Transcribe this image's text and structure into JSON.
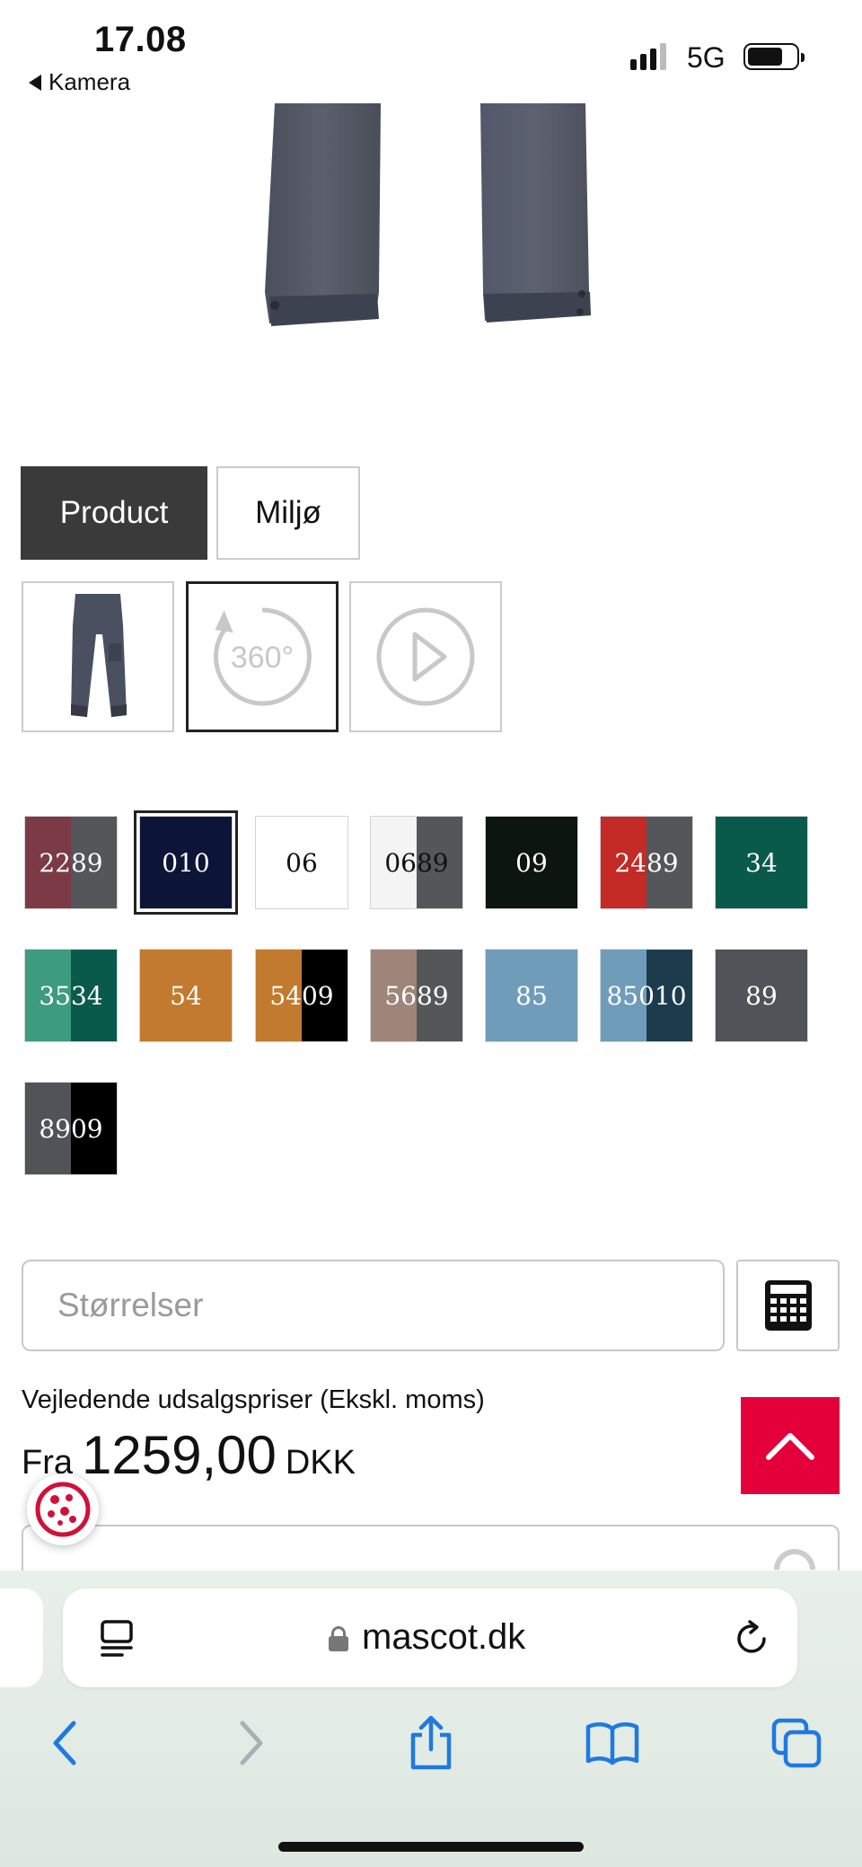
{
  "status_bar": {
    "time": "17.08",
    "back_app": "Kamera",
    "network": "5G"
  },
  "tabs": [
    {
      "label": "Product",
      "active": true
    },
    {
      "label": "Miljø",
      "active": false
    }
  ],
  "media": [
    {
      "type": "image",
      "icon": "trousers-thumbnail"
    },
    {
      "type": "360",
      "label": "360°",
      "icon": "rotate-360-icon",
      "selected": true
    },
    {
      "type": "video",
      "icon": "play-icon"
    }
  ],
  "colors": [
    {
      "code": "2289",
      "fill": [
        "#7c3a47",
        "#555659"
      ],
      "text": "#ffffff",
      "selected": false
    },
    {
      "code": "010",
      "fill": [
        "#0c1438"
      ],
      "text": "#ffffff",
      "selected": true
    },
    {
      "code": "06",
      "fill": [
        "#ffffff"
      ],
      "text": "#111111",
      "selected": false
    },
    {
      "code": "0689",
      "fill": [
        "#f4f4f4",
        "#555659"
      ],
      "text": "#111111",
      "selected": false
    },
    {
      "code": "09",
      "fill": [
        "#0d1510"
      ],
      "text": "#ffffff",
      "selected": false
    },
    {
      "code": "2489",
      "fill": [
        "#c42a26",
        "#555659"
      ],
      "text": "#ffffff",
      "selected": false
    },
    {
      "code": "34",
      "fill": [
        "#0a5a4c"
      ],
      "text": "#ffffff",
      "selected": false
    },
    {
      "code": "3534",
      "fill": [
        "#3d9b80",
        "#0a5a4c"
      ],
      "text": "#ffffff",
      "selected": false
    },
    {
      "code": "54",
      "fill": [
        "#c27a2f"
      ],
      "text": "#ffffff",
      "selected": false
    },
    {
      "code": "5409",
      "fill": [
        "#c27a2f",
        "#000000"
      ],
      "text": "#ffffff",
      "selected": false
    },
    {
      "code": "5689",
      "fill": [
        "#9e8479",
        "#555659"
      ],
      "text": "#ffffff",
      "selected": false
    },
    {
      "code": "85",
      "fill": [
        "#6f9db9"
      ],
      "text": "#ffffff",
      "selected": false
    },
    {
      "code": "85010",
      "fill": [
        "#6f9db9",
        "#1c3c4e"
      ],
      "text": "#ffffff",
      "selected": false
    },
    {
      "code": "89",
      "fill": [
        "#505357"
      ],
      "text": "#ffffff",
      "selected": false
    },
    {
      "code": "8909",
      "fill": [
        "#505357",
        "#000000"
      ],
      "text": "#ffffff",
      "selected": false
    }
  ],
  "size_selector": {
    "placeholder": "Størrelser",
    "calculator_icon": "calculator-icon"
  },
  "price": {
    "note": "Vejledende udsalgspriser (Ekskl. moms)",
    "prefix": "Fra",
    "value": "1259,00",
    "currency": "DKK"
  },
  "accent_color": "#e4003b",
  "browser": {
    "domain": "mascot.dk",
    "toolbar": [
      "back-icon",
      "forward-icon",
      "share-icon",
      "bookmarks-icon",
      "tabs-icon"
    ]
  }
}
